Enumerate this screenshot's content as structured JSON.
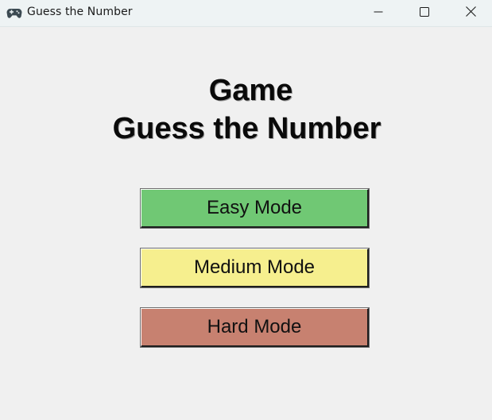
{
  "window": {
    "title": "Guess the Number",
    "app_icon": "gamepad-icon",
    "controls": {
      "minimize": "minimize-icon",
      "maximize": "maximize-icon",
      "close": "close-icon"
    }
  },
  "main": {
    "heading_line1": "Game",
    "heading_line2": "Guess the Number",
    "buttons": [
      {
        "label": "Easy Mode",
        "color": "#70c874"
      },
      {
        "label": "Medium Mode",
        "color": "#f6ef8e"
      },
      {
        "label": "Hard Mode",
        "color": "#c78170"
      }
    ]
  },
  "colors": {
    "background": "#f0f0f0",
    "titlebar": "#eef3f4"
  }
}
